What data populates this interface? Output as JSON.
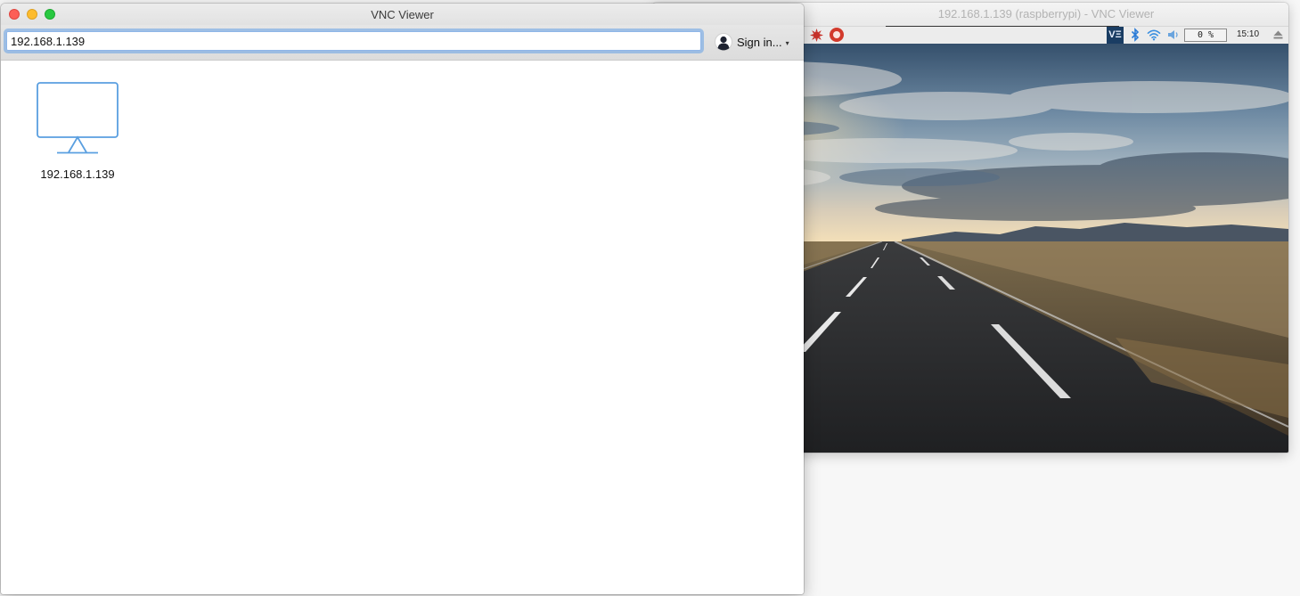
{
  "viewer_window": {
    "title": "VNC Viewer",
    "address_value": "192.168.1.139",
    "sign_in_label": "Sign in...",
    "sign_in_caret": "▾",
    "computers": [
      {
        "label": "192.168.1.139",
        "icon": "monitor-icon"
      }
    ]
  },
  "remote_window": {
    "title": "192.168.1.139 (raspberrypi) - VNC Viewer",
    "panel": {
      "vnc_icon_text": "VΞ",
      "cpu_usage": "0 %",
      "clock": "15:10"
    }
  },
  "colors": {
    "accent_blue": "#5a9fe0",
    "traffic_close": "#fc5f57",
    "traffic_min": "#fdbc2e",
    "traffic_max": "#28c840"
  }
}
